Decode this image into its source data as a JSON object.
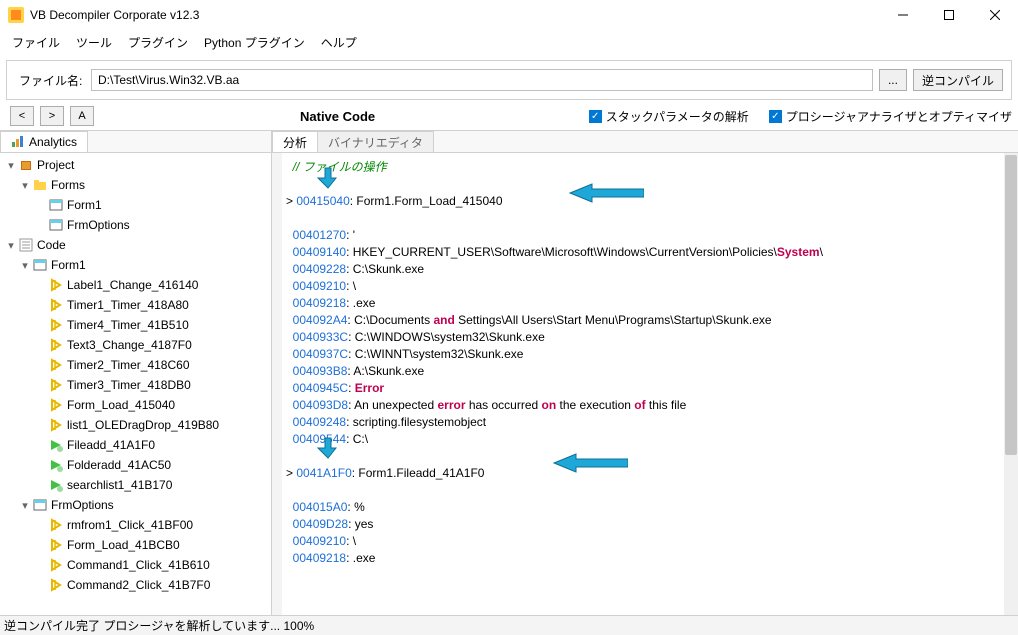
{
  "window": {
    "title": "VB Decompiler Corporate v12.3"
  },
  "menu": {
    "items": [
      "ファイル",
      "ツール",
      "プラグイン",
      "Python プラグイン",
      "ヘルプ"
    ]
  },
  "filebar": {
    "label": "ファイル名:",
    "value": "D:\\Test\\Virus.Win32.VB.aa",
    "browse": "...",
    "decompile": "逆コンパイル"
  },
  "subbar": {
    "back": "<",
    "fwd": ">",
    "analyze_btn": "A",
    "title": "Native Code",
    "check1": "スタックパラメータの解析",
    "check2": "プロシージャアナライザとオプティマイザ"
  },
  "left": {
    "tab_analytics": "Analytics",
    "tree": {
      "project": "Project",
      "forms": "Forms",
      "form1": "Form1",
      "frmoptions": "FrmOptions",
      "code": "Code",
      "form1_items": [
        "Label1_Change_416140",
        "Timer1_Timer_418A80",
        "Timer4_Timer_41B510",
        "Text3_Change_4187F0",
        "Timer2_Timer_418C60",
        "Timer3_Timer_418DB0",
        "Form_Load_415040",
        "list1_OLEDragDrop_419B80"
      ],
      "fileadd": "Fileadd_41A1F0",
      "folderadd": "Folderadd_41AC50",
      "searchlist": "searchlist1_41B170",
      "frmoptions_items": [
        "rmfrom1_Click_41BF00",
        "Form_Load_41BCB0",
        "Command1_Click_41B610",
        "Command2_Click_41B7F0"
      ]
    }
  },
  "right": {
    "tab_analysis": "分析",
    "tab_binary": "バイナリエディタ",
    "code": {
      "comment1": "// ファイルの操作",
      "marker": ">",
      "colon": ":",
      "lines": [
        {
          "addr": "00415040",
          "text": "Form1.Form_Load_415040",
          "marker": true
        },
        {
          "spacer": true
        },
        {
          "addr": "00401270",
          "text": "'"
        },
        {
          "addr": "00409140",
          "text_parts": [
            "HKEY_CURRENT_USER\\Software\\Microsoft\\Windows\\CurrentVersion\\Policies\\",
            "System",
            "\\"
          ]
        },
        {
          "addr": "00409228",
          "text": "C:\\Skunk.exe"
        },
        {
          "addr": "00409210",
          "text": "\\"
        },
        {
          "addr": "00409218",
          "text": ".exe"
        },
        {
          "addr": "004092A4",
          "text_parts": [
            "C:\\Documents ",
            "and",
            " Settings\\All Users\\Start Menu\\Programs\\Startup\\Skunk.exe"
          ]
        },
        {
          "addr": "0040933C",
          "text": "C:\\WINDOWS\\system32\\Skunk.exe"
        },
        {
          "addr": "0040937C",
          "text": "C:\\WINNT\\system32\\Skunk.exe"
        },
        {
          "addr": "004093B8",
          "text": "A:\\Skunk.exe"
        },
        {
          "addr": "0040945C",
          "kw": "Error"
        },
        {
          "addr": "004093D8",
          "text_parts": [
            "An unexpected ",
            "error",
            " has occurred ",
            "on",
            " the execution ",
            "of",
            " this file"
          ]
        },
        {
          "addr": "00409248",
          "text": "scripting.filesystemobject"
        },
        {
          "addr": "00409544",
          "text": "C:\\"
        },
        {
          "spacer": true
        },
        {
          "addr": "0041A1F0",
          "text": "Form1.Fileadd_41A1F0",
          "marker": true
        },
        {
          "spacer": true
        },
        {
          "addr": "004015A0",
          "text": "%"
        },
        {
          "addr": "00409D28",
          "text": "yes"
        },
        {
          "addr": "00409210",
          "text": "\\"
        },
        {
          "addr": "00409218",
          "text": ".exe"
        }
      ]
    }
  },
  "status": {
    "text": "逆コンパイル完了 プロシージャを解析しています... 100%"
  }
}
